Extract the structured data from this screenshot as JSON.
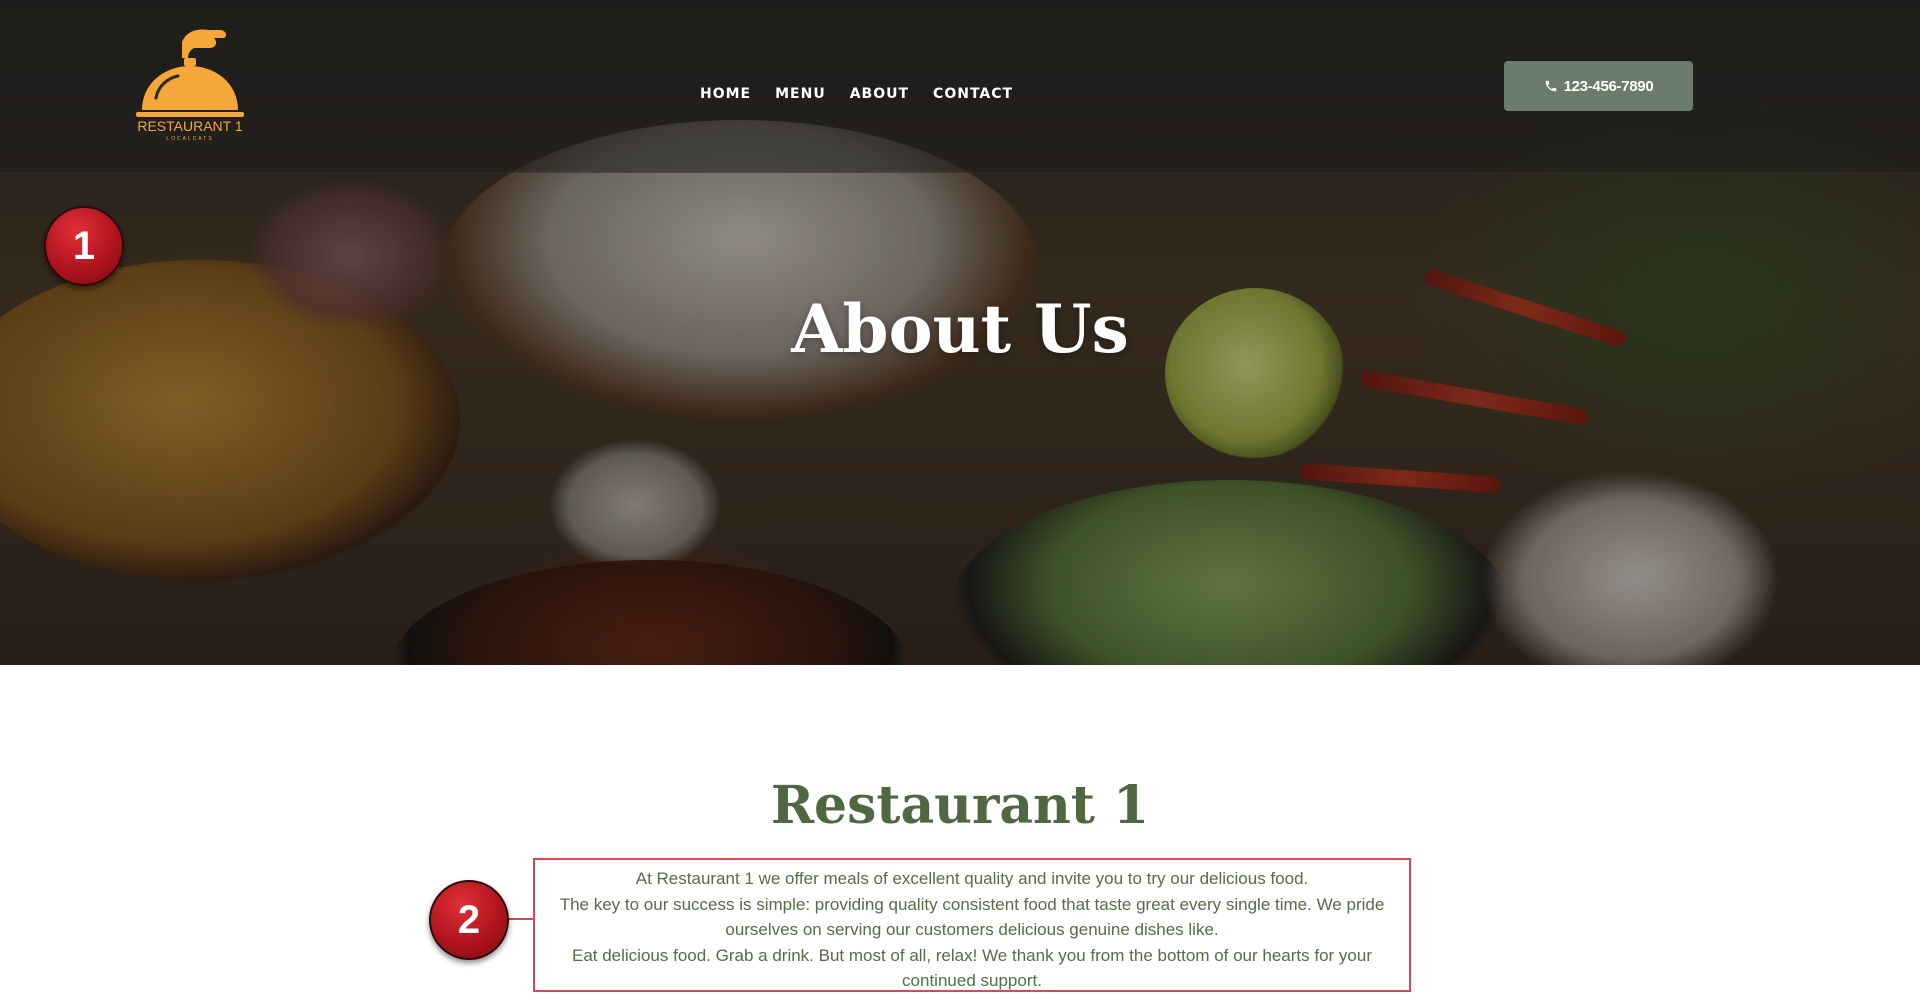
{
  "logo": {
    "name": "RESTAURANT 1",
    "tagline": "LOCALCATS"
  },
  "nav": {
    "items": [
      {
        "label": "HOME"
      },
      {
        "label": "MENU"
      },
      {
        "label": "ABOUT"
      },
      {
        "label": "CONTACT"
      }
    ]
  },
  "phone_button": {
    "label": "123-456-7890",
    "icon": "phone-icon",
    "color": "#6b7c6a"
  },
  "hero": {
    "title": "About Us"
  },
  "about": {
    "title": "Restaurant 1",
    "title_color": "#4f6841",
    "paragraphs": [
      "At Restaurant 1 we offer meals of excellent quality and invite you to try our delicious food.",
      "The key to our success is simple: providing quality consistent food that taste great every single time. We pride ourselves on serving our customers delicious genuine dishes like.",
      "Eat delicious food. Grab a drink. But most of all, relax! We thank you from the bottom of our hearts for your continued support."
    ]
  },
  "markers": {
    "one": "1",
    "two": "2"
  },
  "colors": {
    "accent_logo": "#f5a73a",
    "annotation_red": "#d9465a"
  }
}
